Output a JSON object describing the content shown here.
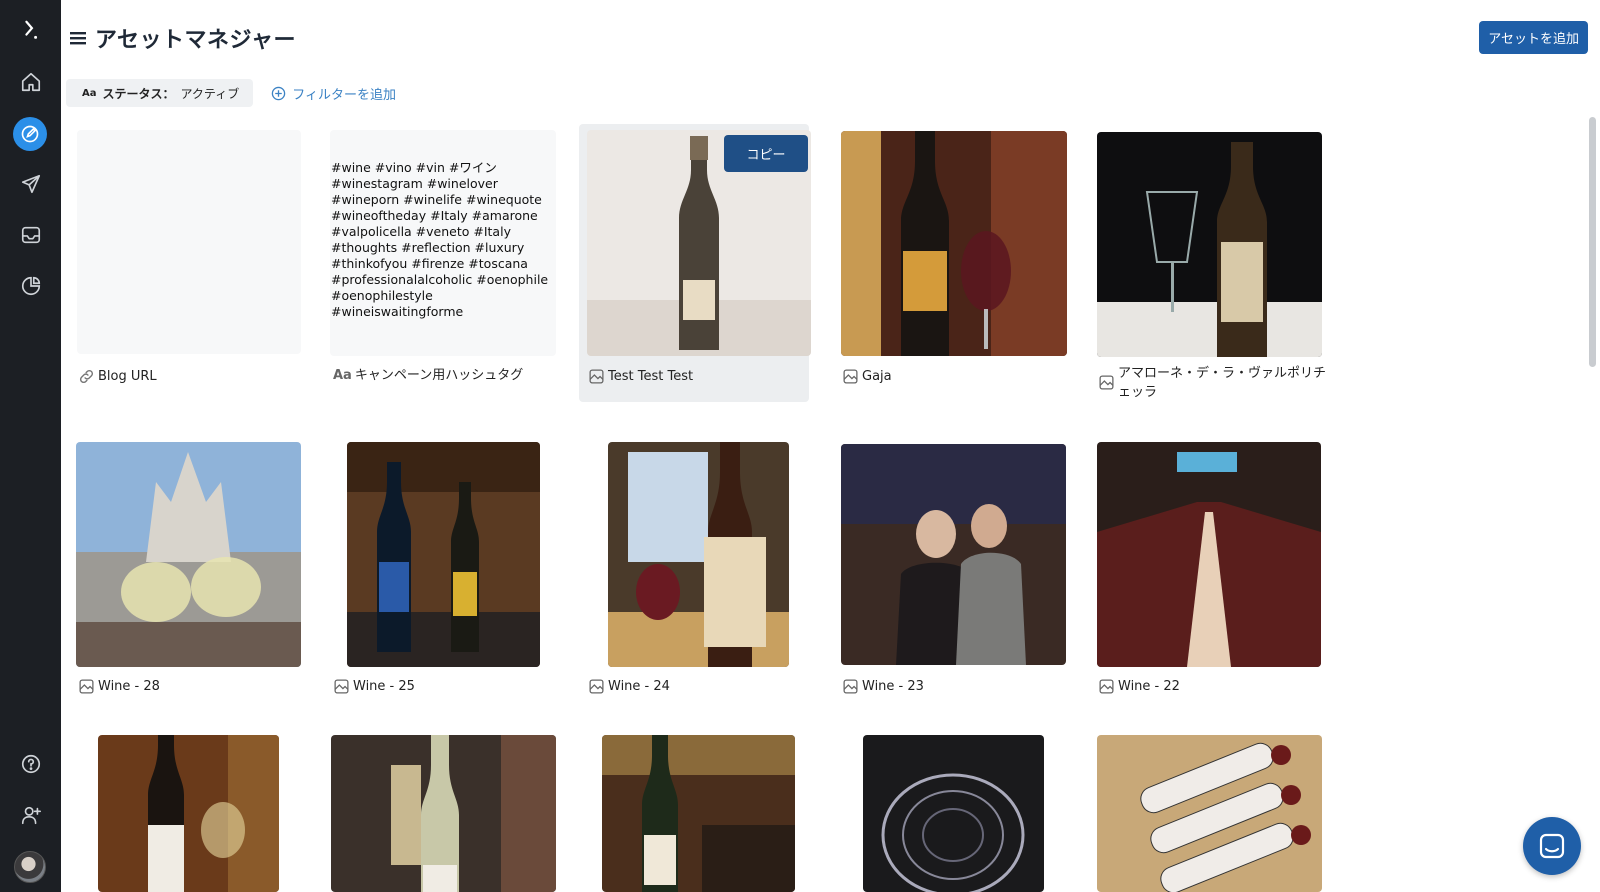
{
  "app": {
    "title": "アセットマネジャー"
  },
  "sidebar": {
    "items": [
      {
        "name": "logo",
        "icon": "logo-icon"
      },
      {
        "name": "home",
        "icon": "home-icon"
      },
      {
        "name": "compose",
        "icon": "edit-icon",
        "active": true
      },
      {
        "name": "publish",
        "icon": "send-icon"
      },
      {
        "name": "inbox",
        "icon": "inbox-icon"
      },
      {
        "name": "analytics",
        "icon": "pie-chart-icon"
      },
      {
        "name": "help",
        "icon": "help-icon"
      },
      {
        "name": "team",
        "icon": "add-user-icon"
      },
      {
        "name": "profile",
        "icon": "avatar"
      }
    ]
  },
  "header": {
    "add_asset_label": "アセットを追加"
  },
  "filters": {
    "chip_prefix": "Aa",
    "chip_key": "ステータス：",
    "chip_value": "アクティブ",
    "add_filter_label": "フィルターを追加"
  },
  "assets": [
    {
      "label": "Blog URL",
      "type": "link",
      "icon": "link-icon"
    },
    {
      "label": "キャンペーン用ハッシュタグ",
      "type": "text",
      "icon": "text-icon",
      "text": "#wine #vino #vin #ワイン\n#winestagram #winelover\n#wineporn #winelife #winequote\n#wineoftheday #Italy #amarone\n#valpolicella #veneto #Italy\n#thoughts #reflection #luxury\n#thinkofyou #firenze #toscana\n#professionalalcoholic #oenophile\n#oenophilestyle\n#wineiswaitingforme"
    },
    {
      "label": "Test Test Test",
      "type": "image",
      "icon": "image-icon",
      "hover_action": "コピー"
    },
    {
      "label": "Gaja",
      "type": "image",
      "icon": "image-icon"
    },
    {
      "label": "アマローネ・デ・ラ・ヴァルポリチェッラ",
      "type": "image",
      "icon": "image-icon"
    },
    {
      "label": "Wine - 28",
      "type": "image",
      "icon": "image-icon"
    },
    {
      "label": "Wine - 25",
      "type": "image",
      "icon": "image-icon"
    },
    {
      "label": "Wine - 24",
      "type": "image",
      "icon": "image-icon"
    },
    {
      "label": "Wine - 23",
      "type": "image",
      "icon": "image-icon"
    },
    {
      "label": "Wine - 22",
      "type": "image",
      "icon": "image-icon"
    },
    {
      "label": "",
      "type": "image",
      "icon": "image-icon"
    },
    {
      "label": "",
      "type": "image",
      "icon": "image-icon"
    },
    {
      "label": "",
      "type": "image",
      "icon": "image-icon"
    },
    {
      "label": "",
      "type": "image",
      "icon": "image-icon"
    },
    {
      "label": "",
      "type": "image",
      "icon": "image-icon"
    }
  ],
  "colors": {
    "sidebar_bg": "#1c1f24",
    "accent": "#2b8fe8",
    "primary_button": "#1f5fa8",
    "link": "#3b82c4"
  },
  "chat": {
    "icon": "chat-icon"
  }
}
